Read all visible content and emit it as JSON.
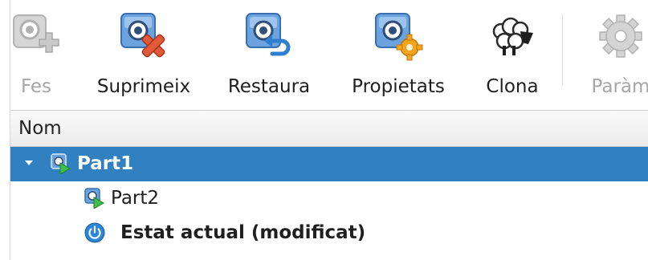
{
  "toolbar": {
    "items": [
      {
        "label": "Fes",
        "icon": "snapshot-take-icon",
        "enabled": false
      },
      {
        "label": "Suprimeix",
        "icon": "snapshot-delete-icon",
        "enabled": true
      },
      {
        "label": "Restaura",
        "icon": "snapshot-restore-icon",
        "enabled": true
      },
      {
        "label": "Propietats",
        "icon": "snapshot-properties-icon",
        "enabled": true
      },
      {
        "label": "Clona",
        "icon": "sheep-clone-icon",
        "enabled": true
      },
      {
        "label": "Paràm",
        "icon": "gear-settings-icon",
        "enabled": false
      }
    ]
  },
  "tree": {
    "column_header": "Nom",
    "rows": [
      {
        "label": "Part1",
        "icon": "snapshot-icon",
        "selected": true,
        "expanded": true
      },
      {
        "label": "Part2",
        "icon": "snapshot-icon",
        "selected": false
      },
      {
        "label": "Estat actual (modificat)",
        "icon": "power-state-icon",
        "selected": false
      }
    ]
  },
  "colors": {
    "selection": "#3181c1",
    "disabled_text": "#a6a6a6",
    "delete_red": "#e05a3a",
    "restore_blue": "#2f7fd1",
    "properties_orange": "#f2a51e",
    "power_blue": "#2a86d6"
  }
}
